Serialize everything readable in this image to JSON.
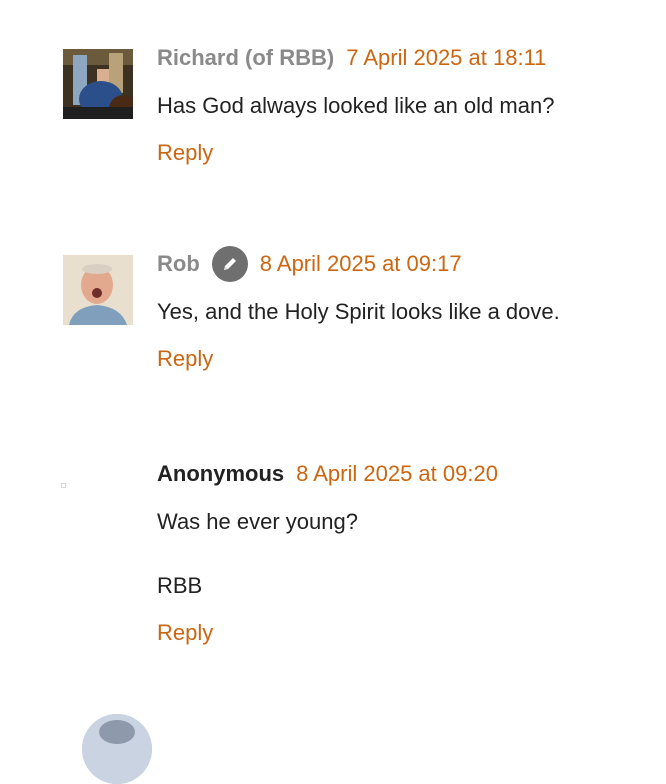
{
  "comments": [
    {
      "author": "Richard (of RBB)",
      "timestamp": "7 April 2025 at 18:11",
      "paragraphs": [
        "Has God always looked like an old man?"
      ],
      "reply_label": "Reply",
      "avatar": "photo-man-in-room"
    },
    {
      "author": "Rob",
      "badge_icon": "pencil-icon",
      "timestamp": "8 April 2025 at 09:17",
      "paragraphs": [
        "Yes, and the Holy Spirit looks like a dove."
      ],
      "reply_label": "Reply",
      "avatar": "photo-man-face"
    },
    {
      "author": "Anonymous",
      "timestamp": "8 April 2025 at 09:20",
      "paragraphs": [
        "Was he ever young?",
        "RBB"
      ],
      "reply_label": "Reply",
      "avatar": "blank-avatar"
    }
  ],
  "colors": {
    "link": "#cc6611",
    "author_grey": "#8a8a8a",
    "text": "#222222"
  }
}
